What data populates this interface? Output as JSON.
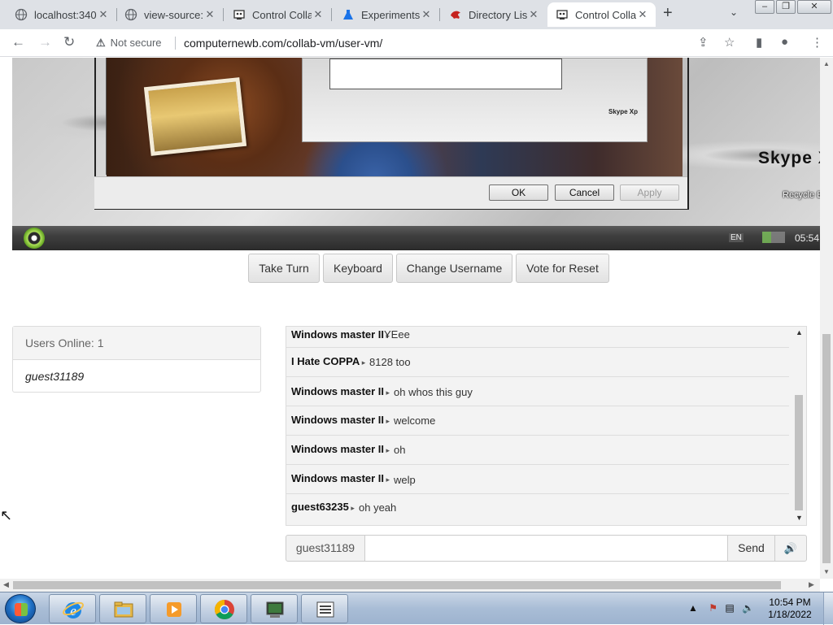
{
  "browser": {
    "tabs": [
      {
        "title": "localhost:340",
        "icon": "globe-icon"
      },
      {
        "title": "view-source:",
        "icon": "globe-icon"
      },
      {
        "title": "Control Colla",
        "icon": "collabvm-icon"
      },
      {
        "title": "Experiments",
        "icon": "flask-icon"
      },
      {
        "title": "Directory Lis",
        "icon": "red-dragon-icon"
      },
      {
        "title": "Control Colla",
        "icon": "collabvm-icon",
        "active": true
      }
    ],
    "security_label": "Not secure",
    "security_icon": "warning-icon",
    "url": "computernewb.com/collab-vm/user-vm/"
  },
  "vm": {
    "dialog_buttons": {
      "ok": "OK",
      "cancel": "Cancel",
      "apply": "Apply"
    },
    "skype_small": "Skype Xp",
    "skype_big": "Skype X",
    "recycle": "Recycle B",
    "language": "EN",
    "clock": "05:54"
  },
  "controls": {
    "take_turn": "Take Turn",
    "keyboard": "Keyboard",
    "change_username": "Change Username",
    "vote_reset": "Vote for Reset"
  },
  "users": {
    "header": "Users Online: 1",
    "list": [
      "guest31189"
    ]
  },
  "chat": {
    "messages": [
      {
        "user": "Windows master II",
        "text": "YEee"
      },
      {
        "user": "I Hate COPPA",
        "text": "8128 too"
      },
      {
        "user": "Windows master II",
        "text": "oh whos this guy"
      },
      {
        "user": "Windows master II",
        "text": "welcome"
      },
      {
        "user": "Windows master II",
        "text": "oh"
      },
      {
        "user": "Windows master II",
        "text": "welp"
      },
      {
        "user": "guest63235",
        "text": "oh yeah"
      }
    ],
    "username": "guest31189",
    "input_value": "",
    "send_label": "Send",
    "sound_icon": "speaker-icon"
  },
  "taskbar": {
    "apps": [
      "internet-explorer-icon",
      "folder-icon",
      "media-player-icon",
      "chrome-icon",
      "vm-console-icon",
      "list-icon"
    ],
    "time": "10:54 PM",
    "date": "1/18/2022"
  }
}
